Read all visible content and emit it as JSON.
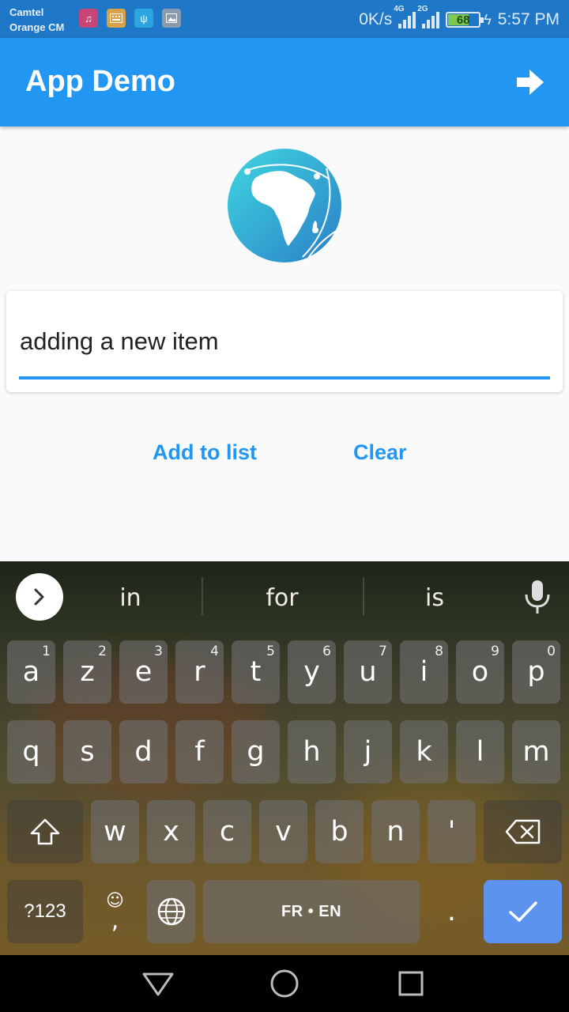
{
  "status_bar": {
    "carrier_line1": "Camtel",
    "carrier_line2": "Orange CM",
    "speed": "0K/s",
    "network_1": "4G",
    "network_2": "2G",
    "battery_level": 68,
    "battery_text": "68",
    "time": "5:57 PM",
    "notification_icons": [
      "music-icon",
      "keyboard-icon",
      "usb-icon",
      "image-icon"
    ]
  },
  "app_bar": {
    "title": "App Demo",
    "action_icon": "exit-arrow-icon"
  },
  "logo": {
    "icon": "africa-globe-icon"
  },
  "input": {
    "value": "adding a new item",
    "accent": "#2196f3"
  },
  "buttons": {
    "add": "Add to list",
    "clear": "Clear"
  },
  "keyboard": {
    "suggestions": [
      "in",
      "for",
      "is"
    ],
    "row1": [
      {
        "label": "a",
        "hint": "1"
      },
      {
        "label": "z",
        "hint": "2"
      },
      {
        "label": "e",
        "hint": "3"
      },
      {
        "label": "r",
        "hint": "4"
      },
      {
        "label": "t",
        "hint": "5"
      },
      {
        "label": "y",
        "hint": "6"
      },
      {
        "label": "u",
        "hint": "7"
      },
      {
        "label": "i",
        "hint": "8"
      },
      {
        "label": "o",
        "hint": "9"
      },
      {
        "label": "p",
        "hint": "0"
      }
    ],
    "row2": [
      "q",
      "s",
      "d",
      "f",
      "g",
      "h",
      "j",
      "k",
      "l",
      "m"
    ],
    "row3": [
      "w",
      "x",
      "c",
      "v",
      "b",
      "n",
      "'"
    ],
    "symbols_label": "?123",
    "comma_label": ",",
    "space_label": "FR • EN",
    "period_label": ".",
    "enter_color": "#5b93ee"
  },
  "colors": {
    "status_bar": "#1f78c7",
    "app_bar": "#2196f3",
    "background": "#fafafa"
  }
}
